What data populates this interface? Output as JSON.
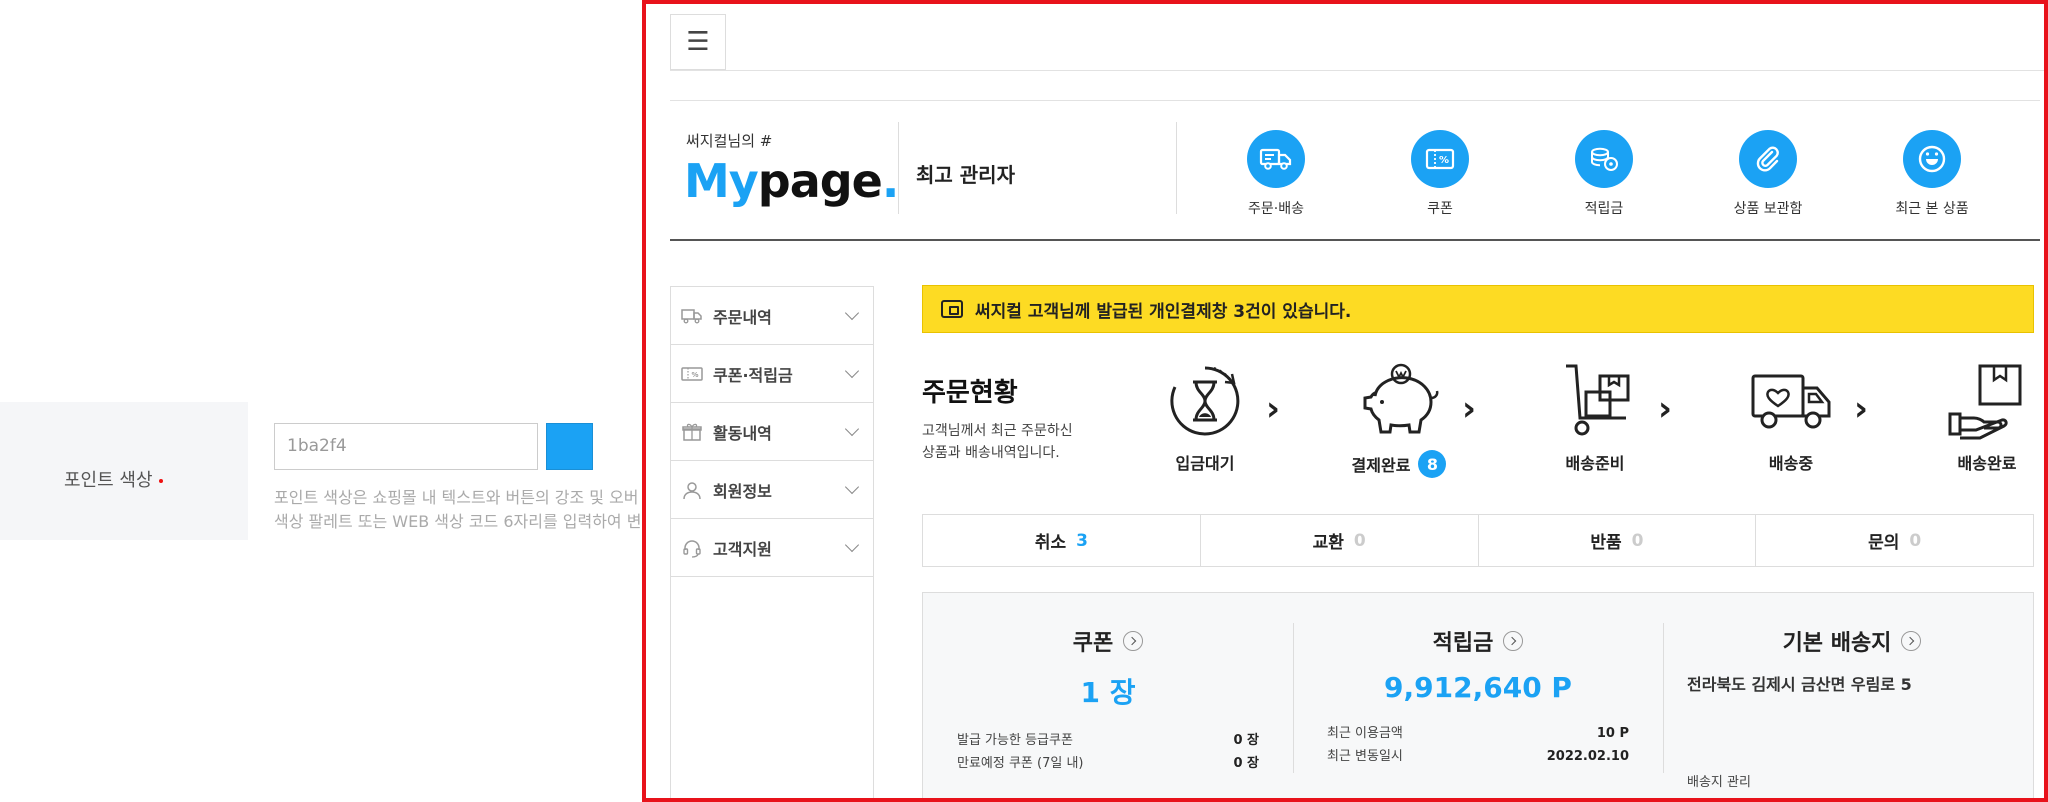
{
  "settings": {
    "label": "포인트 색상",
    "color_value": "1ba2f4",
    "swatch_color": "#1ba2f4",
    "description_line1": "포인트 색상은 쇼핑몰 내 텍스트와 버튼의 강조 및 오버",
    "description_line2": "색상 팔레트 또는 WEB 색상 코드 6자리를 입력하여 변"
  },
  "header": {
    "menu_icon": "☰",
    "greeting": "써지컬님의 #",
    "logo_part1": "My",
    "logo_part2": "page",
    "logo_dot": ".",
    "user_grade": "최고 관리자",
    "quick_links": [
      {
        "label": "주문·배송",
        "icon": "truck-icon"
      },
      {
        "label": "쿠폰",
        "icon": "coupon-icon"
      },
      {
        "label": "적립금",
        "icon": "coins-icon"
      },
      {
        "label": "상품 보관함",
        "icon": "paperclip-icon"
      },
      {
        "label": "최근 본 상품",
        "icon": "smile-icon"
      }
    ]
  },
  "sidebar": {
    "items": [
      {
        "label": "주문내역",
        "icon": "truck-icon"
      },
      {
        "label": "쿠폰·적립금",
        "icon": "coupon-icon"
      },
      {
        "label": "활동내역",
        "icon": "gift-icon"
      },
      {
        "label": "회원정보",
        "icon": "user-icon"
      },
      {
        "label": "고객지원",
        "icon": "headset-icon"
      }
    ]
  },
  "notice": {
    "text": "써지컬 고객님께 발급된 개인결제창 3건이 있습니다."
  },
  "order_status": {
    "title": "주문현황",
    "desc_line1": "고객님께서 최근 주문하신",
    "desc_line2": "상품과 배송내역입니다.",
    "steps": [
      {
        "label": "입금대기",
        "badge": null
      },
      {
        "label": "결제완료",
        "badge": "8"
      },
      {
        "label": "배송준비",
        "badge": null
      },
      {
        "label": "배송중",
        "badge": null
      },
      {
        "label": "배송완료",
        "badge": null
      }
    ],
    "arrow": "›"
  },
  "claims": [
    {
      "label": "취소",
      "count": "3"
    },
    {
      "label": "교환",
      "count": "0"
    },
    {
      "label": "반품",
      "count": "0"
    },
    {
      "label": "문의",
      "count": "0"
    }
  ],
  "summary": {
    "coupon": {
      "title": "쿠폰",
      "value": "1 장",
      "rows": [
        {
          "label": "발급 가능한 등급쿠폰",
          "value": "0 장"
        },
        {
          "label": "만료예정 쿠폰 (7일 내)",
          "value": "0 장"
        }
      ]
    },
    "points": {
      "title": "적립금",
      "value": "9,912,640 P",
      "rows": [
        {
          "label": "최근 이용금액",
          "value": "10 P"
        },
        {
          "label": "최근 변동일시",
          "value": "2022.02.10"
        }
      ]
    },
    "address": {
      "title": "기본 배송지",
      "value": "전라북도 김제시 금산면 우림로 5",
      "manage": "배송지 관리"
    }
  }
}
